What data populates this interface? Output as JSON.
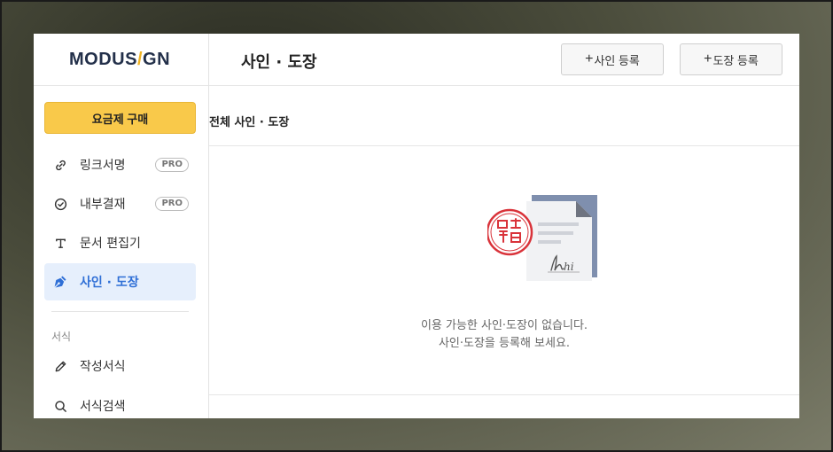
{
  "app": {
    "logo": {
      "part1": "MODUS",
      "slash": "/",
      "part2": "GN"
    }
  },
  "sidebar": {
    "upgrade_label": "요금제 구매",
    "items": [
      {
        "label": "링크서명",
        "badge": "PRO",
        "icon": "link-icon"
      },
      {
        "label": "내부결재",
        "badge": "PRO",
        "icon": "check-circle-icon"
      },
      {
        "label": "문서 편집기",
        "icon": "text-icon"
      },
      {
        "label": "사인 · 도장",
        "icon": "pen-nib-icon",
        "active": true
      }
    ],
    "section_label": "서식",
    "section_items": [
      {
        "label": "작성서식",
        "icon": "pencil-icon"
      },
      {
        "label": "서식검색",
        "icon": "search-icon"
      }
    ]
  },
  "header": {
    "title": "사인 · 도장",
    "register_sign_label": "사인 등록",
    "register_stamp_label": "도장 등록"
  },
  "subheader": {
    "title": "전체 사인 · 도장"
  },
  "empty_state": {
    "line1": "이용 가능한 사인·도장이 없습니다.",
    "line2": "사인·도장을 등록해 보세요.",
    "signature_text": "hi"
  },
  "colors": {
    "accent_yellow": "#f9c94a",
    "active_blue": "#2f6fd6",
    "active_bg": "#e6effc",
    "stamp_red": "#d9333a",
    "doc_blue": "#7f8fae"
  }
}
